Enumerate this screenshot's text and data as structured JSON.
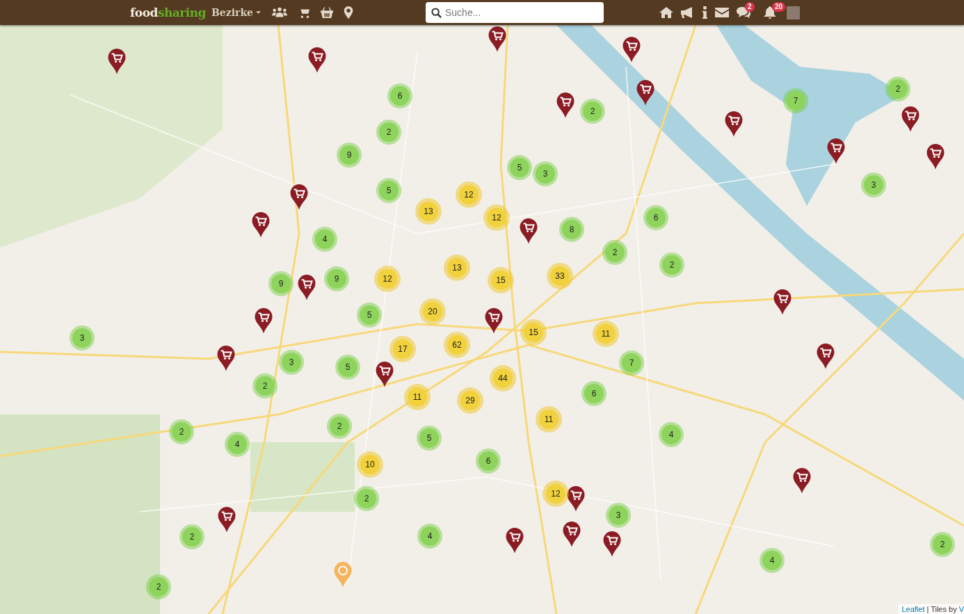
{
  "header": {
    "logo": {
      "first": "food",
      "second": "sharing"
    },
    "menu": "Bezirke",
    "search": {
      "placeholder": "Suche..."
    },
    "badges": {
      "messages": "2",
      "notifications": "20"
    }
  },
  "map": {
    "clusters": [
      {
        "count": "6",
        "kind": "small"
      },
      {
        "count": "2",
        "kind": "small"
      },
      {
        "count": "9",
        "kind": "small"
      },
      {
        "count": "5",
        "kind": "small"
      },
      {
        "count": "4",
        "kind": "small"
      },
      {
        "count": "9",
        "kind": "small"
      },
      {
        "count": "9",
        "kind": "small"
      },
      {
        "count": "5",
        "kind": "small"
      },
      {
        "count": "3",
        "kind": "small"
      },
      {
        "count": "3",
        "kind": "small"
      },
      {
        "count": "5",
        "kind": "small"
      },
      {
        "count": "2",
        "kind": "small"
      },
      {
        "count": "2",
        "kind": "small"
      },
      {
        "count": "2",
        "kind": "small"
      },
      {
        "count": "4",
        "kind": "small"
      },
      {
        "count": "5",
        "kind": "small"
      },
      {
        "count": "6",
        "kind": "small"
      },
      {
        "count": "2",
        "kind": "small"
      },
      {
        "count": "2",
        "kind": "small"
      },
      {
        "count": "4",
        "kind": "small"
      },
      {
        "count": "2",
        "kind": "small"
      },
      {
        "count": "5",
        "kind": "small"
      },
      {
        "count": "3",
        "kind": "small"
      },
      {
        "count": "8",
        "kind": "small"
      },
      {
        "count": "2",
        "kind": "small"
      },
      {
        "count": "2",
        "kind": "small"
      },
      {
        "count": "6",
        "kind": "small"
      },
      {
        "count": "2",
        "kind": "small"
      },
      {
        "count": "6",
        "kind": "small"
      },
      {
        "count": "7",
        "kind": "small"
      },
      {
        "count": "4",
        "kind": "small"
      },
      {
        "count": "3",
        "kind": "small"
      },
      {
        "count": "4",
        "kind": "small"
      },
      {
        "count": "2",
        "kind": "small"
      },
      {
        "count": "7",
        "kind": "small"
      },
      {
        "count": "2",
        "kind": "small"
      },
      {
        "count": "3",
        "kind": "small"
      },
      {
        "count": "12",
        "kind": "medium"
      },
      {
        "count": "13",
        "kind": "medium"
      },
      {
        "count": "12",
        "kind": "medium"
      },
      {
        "count": "13",
        "kind": "medium"
      },
      {
        "count": "12",
        "kind": "medium"
      },
      {
        "count": "15",
        "kind": "medium"
      },
      {
        "count": "33",
        "kind": "medium"
      },
      {
        "count": "20",
        "kind": "medium"
      },
      {
        "count": "15",
        "kind": "medium"
      },
      {
        "count": "11",
        "kind": "medium"
      },
      {
        "count": "17",
        "kind": "medium"
      },
      {
        "count": "62",
        "kind": "medium"
      },
      {
        "count": "44",
        "kind": "medium"
      },
      {
        "count": "11",
        "kind": "medium"
      },
      {
        "count": "29",
        "kind": "medium"
      },
      {
        "count": "11",
        "kind": "medium"
      },
      {
        "count": "10",
        "kind": "medium"
      },
      {
        "count": "12",
        "kind": "medium"
      }
    ],
    "pins": [
      {
        "kind": "shop"
      },
      {
        "kind": "shop"
      },
      {
        "kind": "shop"
      },
      {
        "kind": "shop"
      },
      {
        "kind": "shop"
      },
      {
        "kind": "shop"
      },
      {
        "kind": "shop"
      },
      {
        "kind": "shop"
      },
      {
        "kind": "shop"
      },
      {
        "kind": "shop"
      },
      {
        "kind": "shop"
      },
      {
        "kind": "shop"
      },
      {
        "kind": "shop"
      },
      {
        "kind": "shop"
      },
      {
        "kind": "shop"
      },
      {
        "kind": "shop"
      },
      {
        "kind": "shop"
      },
      {
        "kind": "shop"
      },
      {
        "kind": "shop"
      },
      {
        "kind": "shop"
      },
      {
        "kind": "shop"
      },
      {
        "kind": "shop"
      },
      {
        "kind": "shop"
      },
      {
        "kind": "shop"
      },
      {
        "kind": "shop"
      },
      {
        "kind": "shop"
      },
      {
        "kind": "recycle"
      }
    ],
    "attribution": {
      "link": "Leaflet",
      "text": "| Tiles by",
      "cut": "V"
    }
  }
}
